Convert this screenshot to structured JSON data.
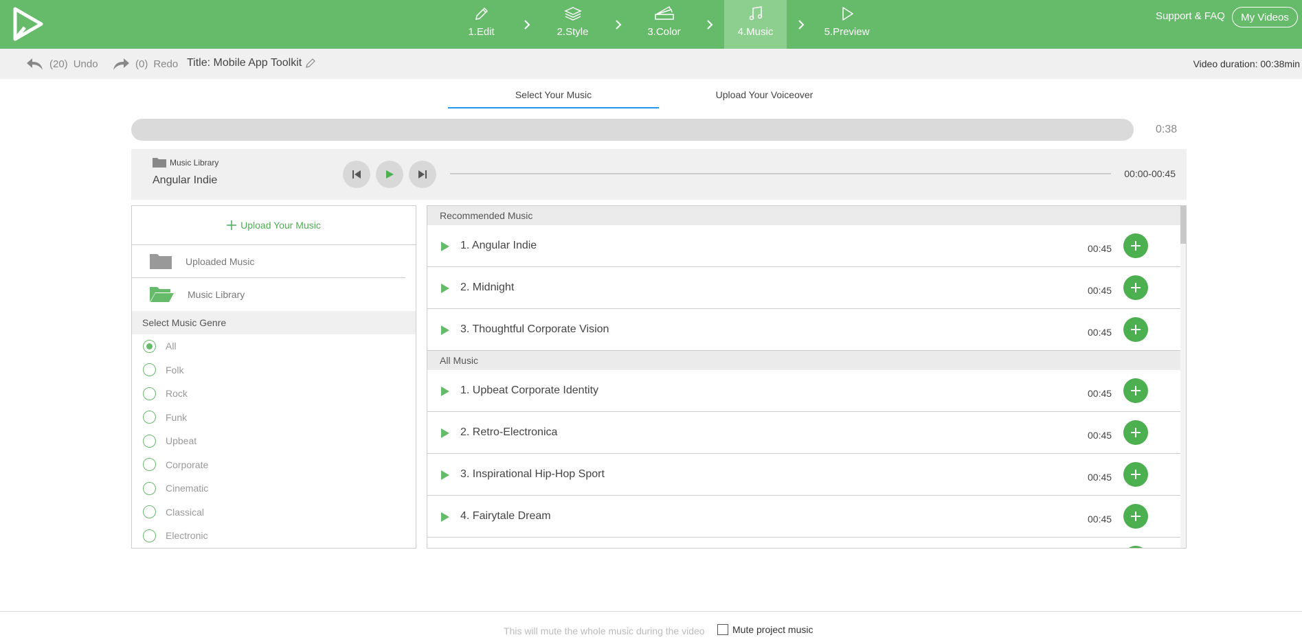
{
  "header": {
    "steps": [
      {
        "label": "1.Edit",
        "icon": "pencil-icon",
        "active": false
      },
      {
        "label": "2.Style",
        "icon": "layers-icon",
        "active": false
      },
      {
        "label": "3.Color",
        "icon": "palette-icon",
        "active": false
      },
      {
        "label": "4.Music",
        "icon": "music-note-icon",
        "active": true
      },
      {
        "label": "5.Preview",
        "icon": "play-outline-icon",
        "active": false
      }
    ],
    "support_label": "Support & FAQ",
    "my_videos_label": "My Videos",
    "brand_color": "#66bb6a"
  },
  "toolbar": {
    "undo_count": "(20)",
    "undo_label": "Undo",
    "redo_count": "(0)",
    "redo_label": "Redo",
    "title": "Title: Mobile App Toolkit",
    "duration": "Video duration: 00:38min"
  },
  "tabs": [
    {
      "label": "Select Your Music",
      "active": true
    },
    {
      "label": "Upload Your Voiceover",
      "active": false
    }
  ],
  "timeline": {
    "time": "0:38"
  },
  "player": {
    "library_label": "Music Library",
    "track_name": "Angular Indie",
    "range": "00:00-00:45"
  },
  "left_panel": {
    "upload_label": "Upload Your Music",
    "uploaded_label": "Uploaded Music",
    "library_label": "Music Library",
    "genre_heading": "Select Music Genre",
    "genres": [
      {
        "label": "All",
        "selected": true
      },
      {
        "label": "Folk",
        "selected": false
      },
      {
        "label": "Rock",
        "selected": false
      },
      {
        "label": "Funk",
        "selected": false
      },
      {
        "label": "Upbeat",
        "selected": false
      },
      {
        "label": "Corporate",
        "selected": false
      },
      {
        "label": "Cinematic",
        "selected": false
      },
      {
        "label": "Classical",
        "selected": false
      },
      {
        "label": "Electronic",
        "selected": false
      }
    ]
  },
  "music_list": {
    "recommended_heading": "Recommended Music",
    "recommended": [
      {
        "name": "1. Angular Indie",
        "duration": "00:45"
      },
      {
        "name": "2. Midnight",
        "duration": "00:45"
      },
      {
        "name": "3. Thoughtful Corporate Vision",
        "duration": "00:45"
      }
    ],
    "all_heading": "All Music",
    "all": [
      {
        "name": "1. Upbeat Corporate Identity",
        "duration": "00:45"
      },
      {
        "name": "2. Retro-Electronica",
        "duration": "00:45"
      },
      {
        "name": "3. Inspirational Hip-Hop Sport",
        "duration": "00:45"
      },
      {
        "name": "4. Fairytale Dream",
        "duration": "00:45"
      }
    ]
  },
  "footer": {
    "note": "This will mute the whole music during the video",
    "mute_label": "Mute project music",
    "mute_checked": false
  }
}
